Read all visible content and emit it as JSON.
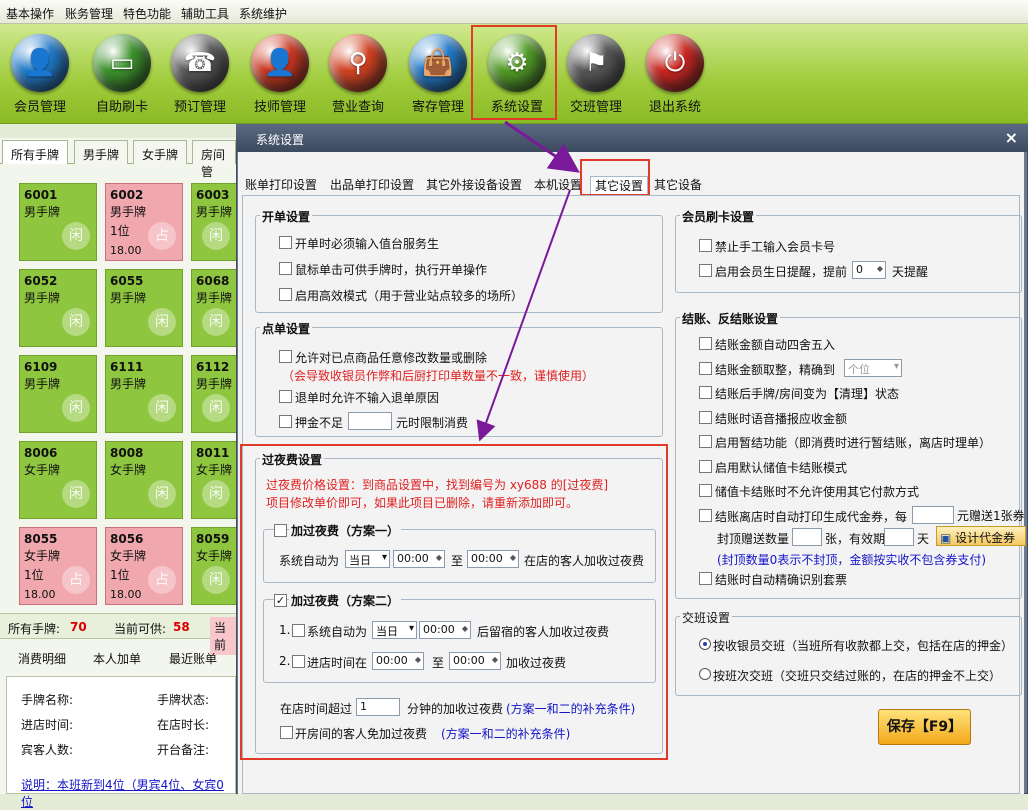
{
  "menubar": [
    "基本操作",
    "账务管理",
    "特色功能",
    "辅助工具",
    "系统维护"
  ],
  "toolbar": [
    {
      "label": "会员管理",
      "color": "#1e78c8",
      "icon": "user-icon",
      "glyph": "👤"
    },
    {
      "label": "自助刷卡",
      "color": "#3a8f2a",
      "icon": "card-icon",
      "glyph": "▭"
    },
    {
      "label": "预订管理",
      "color": "#555555",
      "icon": "phone-icon",
      "glyph": "☎"
    },
    {
      "label": "技师管理",
      "color": "#c8341e",
      "icon": "staff-icon",
      "glyph": "👤"
    },
    {
      "label": "营业查询",
      "color": "#d04020",
      "icon": "search-icon",
      "glyph": "⚲"
    },
    {
      "label": "寄存管理",
      "color": "#1e78c8",
      "icon": "bag-icon",
      "glyph": "👜"
    },
    {
      "label": "系统设置",
      "color": "#4f9a24",
      "icon": "gear-icon",
      "glyph": "⚙"
    },
    {
      "label": "交班管理",
      "color": "#555555",
      "icon": "shift-icon",
      "glyph": "⚑"
    },
    {
      "label": "退出系统",
      "color": "#c8241e",
      "icon": "power-icon",
      "glyph": "⏻"
    }
  ],
  "left": {
    "tabs": [
      "所有手牌",
      "男手牌",
      "女手牌",
      "房间管"
    ],
    "tiles": [
      {
        "id": "6001",
        "type": "男手牌",
        "pink": false,
        "extra": ""
      },
      {
        "id": "6002",
        "type": "男手牌",
        "pink": true,
        "extra": "1位",
        "price": "18.00"
      },
      {
        "id": "6003",
        "type": "男手牌",
        "pink": false,
        "extra": ""
      },
      {
        "id": "6052",
        "type": "男手牌",
        "pink": false,
        "extra": ""
      },
      {
        "id": "6055",
        "type": "男手牌",
        "pink": false,
        "extra": ""
      },
      {
        "id": "6068",
        "type": "男手牌",
        "pink": false,
        "extra": ""
      },
      {
        "id": "6109",
        "type": "男手牌",
        "pink": false,
        "extra": ""
      },
      {
        "id": "6111",
        "type": "男手牌",
        "pink": false,
        "extra": ""
      },
      {
        "id": "6112",
        "type": "男手牌",
        "pink": false,
        "extra": ""
      },
      {
        "id": "8006",
        "type": "女手牌",
        "pink": false,
        "extra": ""
      },
      {
        "id": "8008",
        "type": "女手牌",
        "pink": false,
        "extra": ""
      },
      {
        "id": "8011",
        "type": "女手牌",
        "pink": false,
        "extra": ""
      },
      {
        "id": "8055",
        "type": "女手牌",
        "pink": true,
        "extra": "1位",
        "price": "18.00"
      },
      {
        "id": "8056",
        "type": "女手牌",
        "pink": true,
        "extra": "1位",
        "price": "18.00"
      },
      {
        "id": "8059",
        "type": "女手牌",
        "pink": false,
        "extra": ""
      }
    ],
    "status": {
      "all_label": "所有手牌:",
      "all_value": "70",
      "avail_label": "当前可供:",
      "avail_value": "58",
      "cur_label": "当前"
    },
    "lower_tabs": [
      "消费明细",
      "本人加单",
      "最近账单"
    ],
    "info": {
      "name": "手牌名称:",
      "state": "手牌状态:",
      "enter": "进店时间:",
      "dur": "在店时长:",
      "guests": "宾客人数:",
      "remark": "开台备注:",
      "note": "说明：本班新到4位（男宾4位、女宾0位"
    }
  },
  "dialog": {
    "title": "系统设置",
    "close": "×",
    "tabs": [
      "账单打印设置",
      "出品单打印设置",
      "其它外接设备设置",
      "本机设置",
      "其它设置",
      "其它设备"
    ],
    "open": {
      "title": "开单设置",
      "items": [
        "开单时必须输入值台服务生",
        "鼠标单击可供手牌时，执行开单操作",
        "启用高效模式（用于营业站点较多的场所）"
      ]
    },
    "order": {
      "title": "点单设置",
      "item1": "允许对已点商品任意修改数量或删除",
      "warn": "（会导致收银员作弊和后厨打印单数量不一致，谨慎使用）",
      "item2": "退单时允许不输入退单原因",
      "deposit_pre": "押金不足",
      "deposit_post": "元时限制消费"
    },
    "night": {
      "title": "过夜费设置",
      "hint1": "过夜费价格设置：到商品设置中，找到编号为 xy688 的[过夜费]",
      "hint2": "项目修改单价即可，如果此项目已删除，请重新添加即可。",
      "p1_title": "加过夜费（方案一）",
      "p1_auto": "系统自动为",
      "p1_day": "当日",
      "p1_t1": "00:00",
      "to": "至",
      "p1_t2": "00:00",
      "p1_tail": "在店的客人加收过夜费",
      "p2_title": "加过夜费（方案二）",
      "p2_n1": "1.",
      "p2_auto": "系统自动为",
      "p2_day": "当日",
      "p2_t": "00:00",
      "p2_tail": "后留宿的客人加收过夜费",
      "p2_n2": "2.",
      "p2_in": "进店时间在",
      "p2_t1": "00:00",
      "p2_t2": "00:00",
      "p2_tail2": "加收过夜费",
      "extra1_pre": "在店时间超过",
      "extra1_val": "1",
      "extra1_post": "分钟的加收过夜费",
      "extra_note": "(方案一和二的补充条件)",
      "extra2": "开房间的客人免加过夜费",
      "extra2_note": "(方案一和二的补充条件)"
    },
    "member": {
      "title": "会员刷卡设置",
      "item1": "禁止手工输入会员卡号",
      "item2_pre": "启用会员生日提醒，提前",
      "item2_val": "0",
      "item2_post": "天提醒"
    },
    "checkout": {
      "title": "结账、反结账设置",
      "items": [
        "结账金额自动四舍五入",
        "结账金额取整，精确到",
        "结账后手牌/房间变为【清理】状态",
        "结账时语音播报应收金额",
        "启用暂结功能（即消费时进行暂结账，离店时理单）",
        "启用默认储值卡结账模式",
        "储值卡结账时不允许使用其它付款方式",
        "结账离店时自动打印生成代金券，每"
      ],
      "round_sel": "个位",
      "coupon_tail": "元赠送1张券",
      "cap_pre": "封顶赠送数量",
      "cap_mid": "张，有效期",
      "cap_post": "天",
      "design": "设计代金券",
      "cap_note": "(封顶数量0表示不封顶，金额按实收不包含券支付)",
      "last": "结账时自动精确识别套票"
    },
    "shift": {
      "title": "交班设置",
      "r1": "按收银员交班（当班所有收款都上交，包括在店的押金）",
      "r2": "按班次交班（交班只交结过账的，在店的押金不上交）"
    },
    "save": "保存【F9】"
  }
}
